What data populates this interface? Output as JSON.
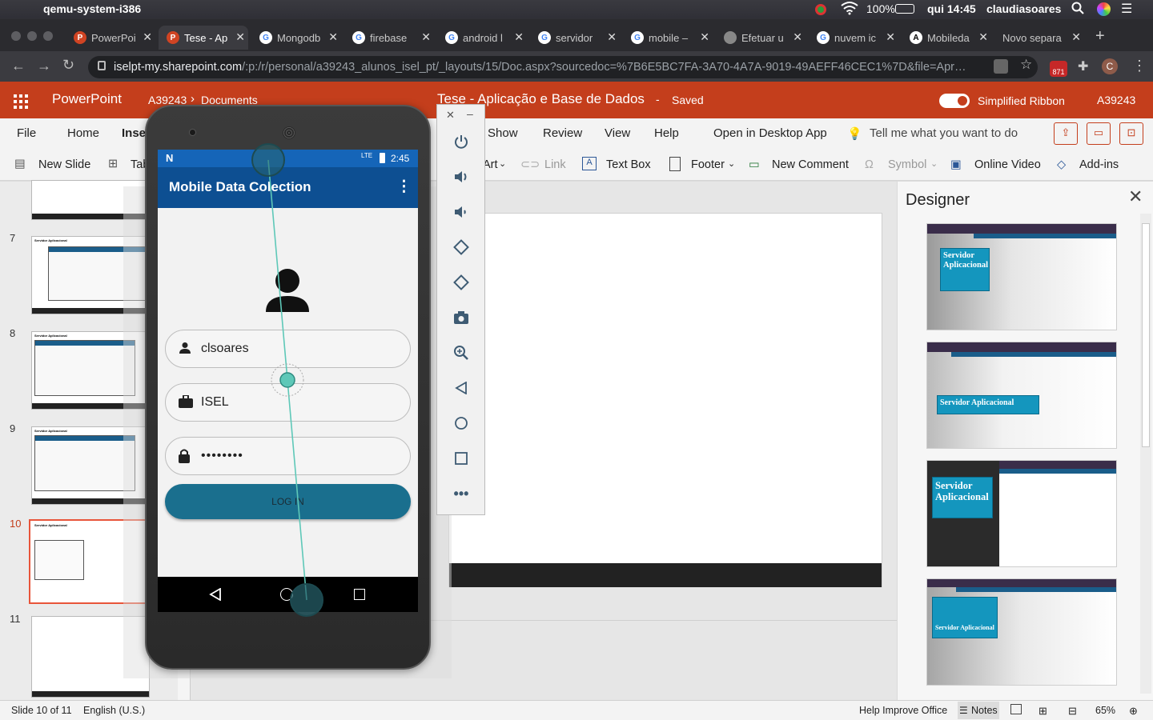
{
  "mac_menubar": {
    "app_name": "qemu-system-i386",
    "battery": "100%",
    "clock": "qui 14:45",
    "user": "claudiasoares"
  },
  "browser": {
    "tabs": [
      {
        "label": "PowerPoi",
        "icon": "powerpoint-icon",
        "active": false
      },
      {
        "label": "Tese - Ap",
        "icon": "powerpoint-icon",
        "active": true
      },
      {
        "label": "Mongodb",
        "icon": "google-icon",
        "active": false
      },
      {
        "label": "firebase",
        "icon": "google-icon",
        "active": false
      },
      {
        "label": "android l",
        "icon": "google-icon",
        "active": false
      },
      {
        "label": "servidor",
        "icon": "google-icon",
        "active": false
      },
      {
        "label": "mobile –",
        "icon": "google-icon",
        "active": false
      },
      {
        "label": "Efetuar u",
        "icon": "apple-icon",
        "active": false
      },
      {
        "label": "nuvem ic",
        "icon": "google-icon",
        "active": false
      },
      {
        "label": "Mobileda",
        "icon": "a-icon",
        "active": false
      },
      {
        "label": "Novo separa",
        "icon": "none",
        "active": false
      }
    ],
    "url_host": "iselpt-my.sharepoint.com",
    "url_path": "/:p:/r/personal/a39243_alunos_isel_pt/_layouts/15/Doc.aspx?sourcedoc=%7B6E5BC7FA-3A70-4A7A-9019-49AEFF46CEC1%7D&file=Apr…",
    "ext_badge": "871",
    "profile_initial": "C"
  },
  "ppt": {
    "app_name": "PowerPoint",
    "breadcrumb_owner": "A39243",
    "breadcrumb_folder": "Documents",
    "doc_title": "Tese - Aplicação e Base de Dados",
    "doc_sep": "-",
    "doc_status": "Saved",
    "simplified_ribbon": "Simplified Ribbon",
    "user": "A39243",
    "ribbon_tabs": [
      "File",
      "Home",
      "Insert",
      "Show",
      "Review",
      "View",
      "Help",
      "Open in Desktop App",
      "Tell me what you want to do"
    ],
    "ribbon_commands": {
      "new_slide": "New Slide",
      "table": "Table",
      "art": "Art",
      "link": "Link",
      "text_box": "Text Box",
      "footer": "Footer",
      "new_comment": "New Comment",
      "symbol": "Symbol",
      "online_video": "Online Video",
      "add_ins": "Add-ins"
    },
    "slide_numbers": [
      "7",
      "8",
      "9",
      "10",
      "11"
    ],
    "thumb_title": "Servidor Aplicacional",
    "designer": {
      "title": "Designer",
      "options": [
        "Servidor Aplicacional",
        "Servidor Aplicacional",
        "Servidor Aplicacional",
        "Servidor Aplicacional"
      ]
    },
    "status": {
      "slide_info": "Slide 10 of 11",
      "language": "English (U.S.)",
      "help": "Help Improve Office",
      "notes": "Notes",
      "zoom": "65%"
    }
  },
  "emulator": {
    "status_time": "2:45",
    "status_network": "LTE",
    "app_title": "Mobile Data Colection",
    "username": "clsoares",
    "organization": "ISEL",
    "password": "••••••••",
    "login_button": "LOG IN"
  },
  "colors": {
    "ppt_orange": "#c43e1c",
    "app_bar": "#0d4f92",
    "status_bar": "#1565b8",
    "login_button": "#1a6f8e",
    "slide_selected": "#e8553a",
    "designer_accent": "#1496be"
  }
}
